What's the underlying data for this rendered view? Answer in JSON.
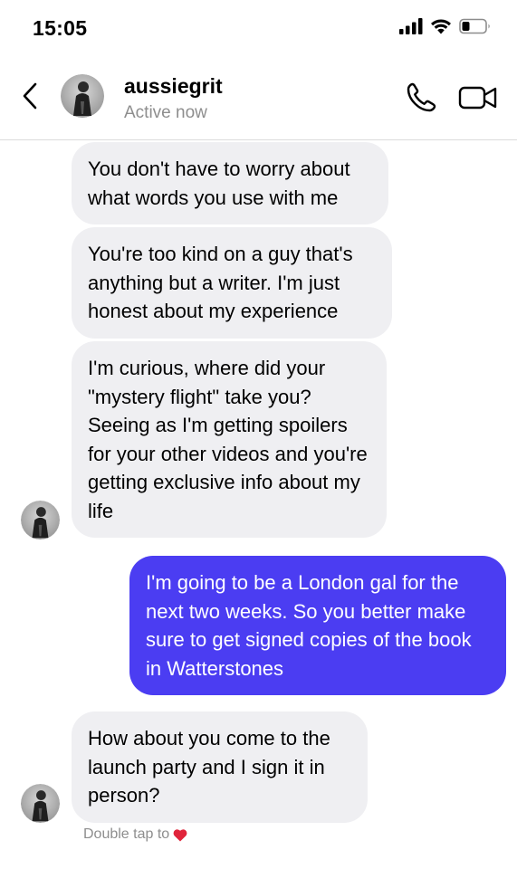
{
  "status_bar": {
    "time": "15:05"
  },
  "header": {
    "username": "aussiegrit",
    "status": "Active now"
  },
  "messages": [
    {
      "sender": "them",
      "text": "You don't have to worry about what words you use with me"
    },
    {
      "sender": "them",
      "text": "You're too kind on a guy that's anything but a writer. I'm just honest about my experience"
    },
    {
      "sender": "them",
      "text": "I'm curious, where did your \"mystery flight\" take you? Seeing as I'm getting spoilers for your other videos and you're getting exclusive info about my life"
    },
    {
      "sender": "me",
      "text": "I'm going to be a London gal for the next two weeks. So you better make sure to get signed copies of the book in Watterstones"
    },
    {
      "sender": "them",
      "text": "How about you come to the launch party and I sign it in person?"
    }
  ],
  "hint": {
    "text": "Double tap to"
  },
  "colors": {
    "outgoing_bubble": "#4b3df2",
    "incoming_bubble": "#efeff2",
    "heart": "#e0243b"
  },
  "icons": [
    "back-chevron-icon",
    "phone-icon",
    "video-camera-icon",
    "heart-icon",
    "signal-icon",
    "wifi-icon",
    "battery-icon"
  ]
}
